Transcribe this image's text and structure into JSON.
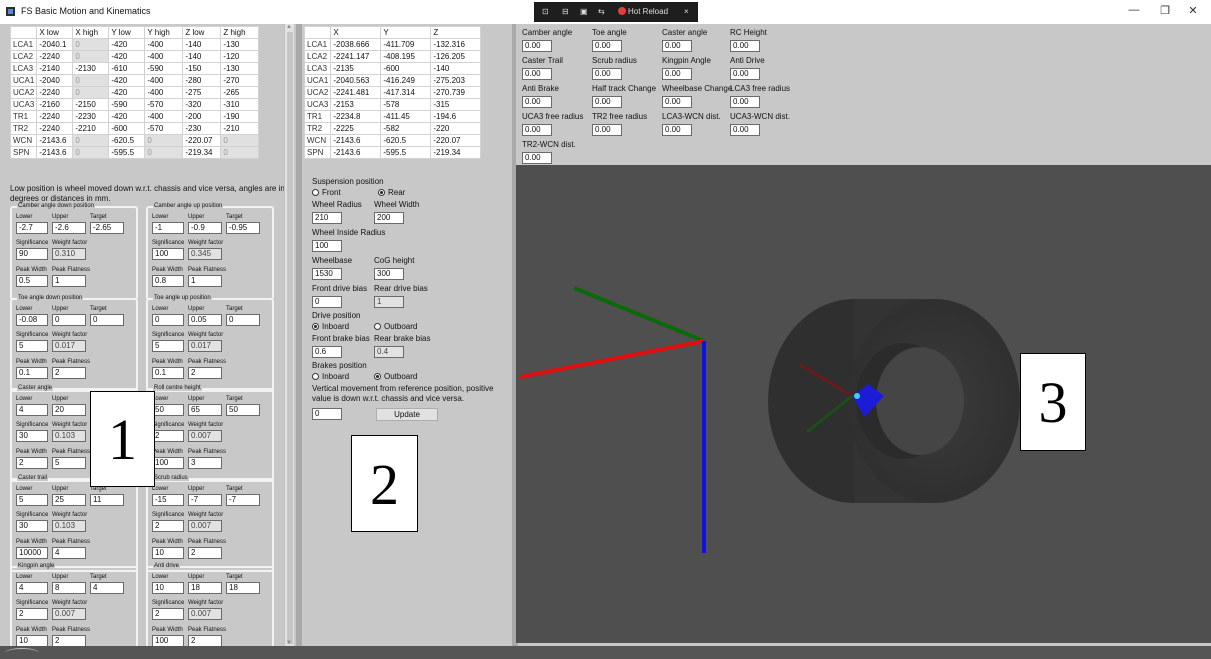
{
  "window": {
    "title": "FS Basic Motion and Kinematics",
    "minimize": "—",
    "maximize": "❐",
    "close": "✕"
  },
  "devbar": {
    "hot_reload": "Hot Reload",
    "close": "×"
  },
  "input_table": {
    "headers": [
      "X low",
      "X high",
      "Y low",
      "Y high",
      "Z low",
      "Z high"
    ],
    "rows": [
      {
        "name": "LCA1",
        "cells": [
          "-2040.1",
          "0",
          "-420",
          "-400",
          "-140",
          "-130"
        ]
      },
      {
        "name": "LCA2",
        "cells": [
          "-2240",
          "0",
          "-420",
          "-400",
          "-140",
          "-120"
        ]
      },
      {
        "name": "LCA3",
        "cells": [
          "-2140",
          "-2130",
          "-610",
          "-590",
          "-150",
          "-130"
        ]
      },
      {
        "name": "UCA1",
        "cells": [
          "-2040",
          "0",
          "-420",
          "-400",
          "-280",
          "-270"
        ]
      },
      {
        "name": "UCA2",
        "cells": [
          "-2240",
          "0",
          "-420",
          "-400",
          "-275",
          "-265"
        ]
      },
      {
        "name": "UCA3",
        "cells": [
          "-2160",
          "-2150",
          "-590",
          "-570",
          "-320",
          "-310"
        ]
      },
      {
        "name": "TR1",
        "cells": [
          "-2240",
          "-2230",
          "-420",
          "-400",
          "-200",
          "-190"
        ]
      },
      {
        "name": "TR2",
        "cells": [
          "-2240",
          "-2210",
          "-600",
          "-570",
          "-230",
          "-210"
        ]
      },
      {
        "name": "WCN",
        "cells": [
          "-2143.6",
          "0",
          "-620.5",
          "0",
          "-220.07",
          "0"
        ]
      },
      {
        "name": "SPN",
        "cells": [
          "-2143.6",
          "0",
          "-595.5",
          "0",
          "-219.34",
          "0"
        ]
      }
    ]
  },
  "note": "Low position is wheel moved down w.r.t. chassis and vice versa, angles are in degrees or distances in mm.",
  "labels": {
    "lower": "Lower",
    "upper": "Upper",
    "target": "Target",
    "significance": "Significance",
    "weight_factor": "Weight factor",
    "peak_width": "Peak Width",
    "peak_flatness": "Peak Flatness"
  },
  "objectives": [
    {
      "caption": "Camber angle down position",
      "lower": "-2.7",
      "upper": "-2.6",
      "target": "-2.65",
      "significance": "90",
      "weight": "0.310",
      "peak_width": "0.5",
      "peak_flatness": "1"
    },
    {
      "caption": "Camber angle up position",
      "lower": "-1",
      "upper": "-0.9",
      "target": "-0.95",
      "significance": "100",
      "weight": "0.345",
      "peak_width": "0.8",
      "peak_flatness": "1"
    },
    {
      "caption": "Toe angle down position",
      "lower": "-0.08",
      "upper": "0",
      "target": "0",
      "significance": "5",
      "weight": "0.017",
      "peak_width": "0.1",
      "peak_flatness": "2"
    },
    {
      "caption": "Toe angle up position",
      "lower": "0",
      "upper": "0.05",
      "target": "0",
      "significance": "5",
      "weight": "0.017",
      "peak_width": "0.1",
      "peak_flatness": "2"
    },
    {
      "caption": "Caster angle",
      "lower": "4",
      "upper": "20",
      "target": "",
      "significance": "30",
      "weight": "0.103",
      "peak_width": "2",
      "peak_flatness": "5"
    },
    {
      "caption": "Roll centre height",
      "lower": "50",
      "upper": "65",
      "target": "50",
      "significance": "2",
      "weight": "0.007",
      "peak_width": "100",
      "peak_flatness": "3"
    },
    {
      "caption": "Caster trail",
      "lower": "5",
      "upper": "25",
      "target": "11",
      "significance": "30",
      "weight": "0.103",
      "peak_width": "10000",
      "peak_flatness": "4"
    },
    {
      "caption": "Scrub radius",
      "lower": "-15",
      "upper": "-7",
      "target": "-7",
      "significance": "2",
      "weight": "0.007",
      "peak_width": "10",
      "peak_flatness": "2"
    },
    {
      "caption": "Kingpin angle",
      "lower": "4",
      "upper": "8",
      "target": "4",
      "significance": "2",
      "weight": "0.007",
      "peak_width": "10",
      "peak_flatness": "2"
    },
    {
      "caption": "Anti drive",
      "lower": "10",
      "upper": "18",
      "target": "18",
      "significance": "2",
      "weight": "0.007",
      "peak_width": "100",
      "peak_flatness": "2"
    }
  ],
  "output_table": {
    "headers": [
      "X",
      "Y",
      "Z"
    ],
    "rows": [
      {
        "name": "LCA1",
        "cells": [
          "-2038.666",
          "-411.709",
          "-132.316"
        ]
      },
      {
        "name": "LCA2",
        "cells": [
          "-2241.147",
          "-408.195",
          "-126.205"
        ]
      },
      {
        "name": "LCA3",
        "cells": [
          "-2135",
          "-600",
          "-140"
        ]
      },
      {
        "name": "UCA1",
        "cells": [
          "-2040.563",
          "-416.249",
          "-275.203"
        ]
      },
      {
        "name": "UCA2",
        "cells": [
          "-2241.481",
          "-417.314",
          "-270.739"
        ]
      },
      {
        "name": "UCA3",
        "cells": [
          "-2153",
          "-578",
          "-315"
        ]
      },
      {
        "name": "TR1",
        "cells": [
          "-2234.8",
          "-411.45",
          "-194.6"
        ]
      },
      {
        "name": "TR2",
        "cells": [
          "-2225",
          "-582",
          "-220"
        ]
      },
      {
        "name": "WCN",
        "cells": [
          "-2143.6",
          "-620.5",
          "-220.07"
        ]
      },
      {
        "name": "SPN",
        "cells": [
          "-2143.6",
          "-595.5",
          "-219.34"
        ]
      }
    ]
  },
  "settings": {
    "suspension_position": "Suspension position",
    "front": "Front",
    "rear": "Rear",
    "wheel_radius": "Wheel Radius",
    "wheel_radius_value": "210",
    "wheel_width": "Wheel Width",
    "wheel_width_value": "200",
    "wheel_inside_radius": "Wheel Inside Radius",
    "wheel_inside_radius_value": "100",
    "wheelbase": "Wheelbase",
    "wheelbase_value": "1530",
    "cog_height": "CoG height",
    "cog_height_value": "300",
    "front_drive_bias": "Front drive bias",
    "front_drive_bias_value": "0",
    "rear_drive_bias": "Rear drive bias",
    "rear_drive_bias_value": "1",
    "drive_position": "Drive position",
    "inboard": "Inboard",
    "outboard": "Outboard",
    "front_brake_bias": "Front brake bias",
    "front_brake_bias_value": "0.6",
    "rear_brake_bias": "Rear brake bias",
    "rear_brake_bias_value": "0.4",
    "brakes_position": "Brakes position",
    "vertical_note": "Vertical movement from reference position, positive value is down w.r.t. chassis and vice versa.",
    "vertical_value": "0",
    "update": "Update"
  },
  "results": [
    {
      "label": "Camber angle",
      "value": "0.00"
    },
    {
      "label": "Toe angle",
      "value": "0.00"
    },
    {
      "label": "Caster angle",
      "value": "0.00"
    },
    {
      "label": "RC Height",
      "value": "0.00"
    },
    {
      "label": "Caster Trail",
      "value": "0.00"
    },
    {
      "label": "Scrub radius",
      "value": "0.00"
    },
    {
      "label": "Kingpin Angle",
      "value": "0.00"
    },
    {
      "label": "Anti Drive",
      "value": "0.00"
    },
    {
      "label": "Anti Brake",
      "value": "0.00"
    },
    {
      "label": "Half track Change",
      "value": "0.00"
    },
    {
      "label": "Wheelbase Change",
      "value": "0.00"
    },
    {
      "label": "LCA3 free radius",
      "value": "0.00"
    },
    {
      "label": "UCA3 free radius",
      "value": "0.00"
    },
    {
      "label": "TR2 free radius",
      "value": "0.00"
    },
    {
      "label": "LCA3-WCN dist.",
      "value": "0.00"
    },
    {
      "label": "UCA3-WCN dist.",
      "value": "0.00"
    },
    {
      "label": "TR2-WCN dist.",
      "value": "0.00"
    }
  ],
  "overlays": [
    "1",
    "2",
    "3"
  ],
  "colors": {
    "axis_x": "#e01010",
    "axis_y": "#0a7a0a",
    "axis_z": "#1010e0",
    "viewport_bg": "#4f4f4f"
  }
}
